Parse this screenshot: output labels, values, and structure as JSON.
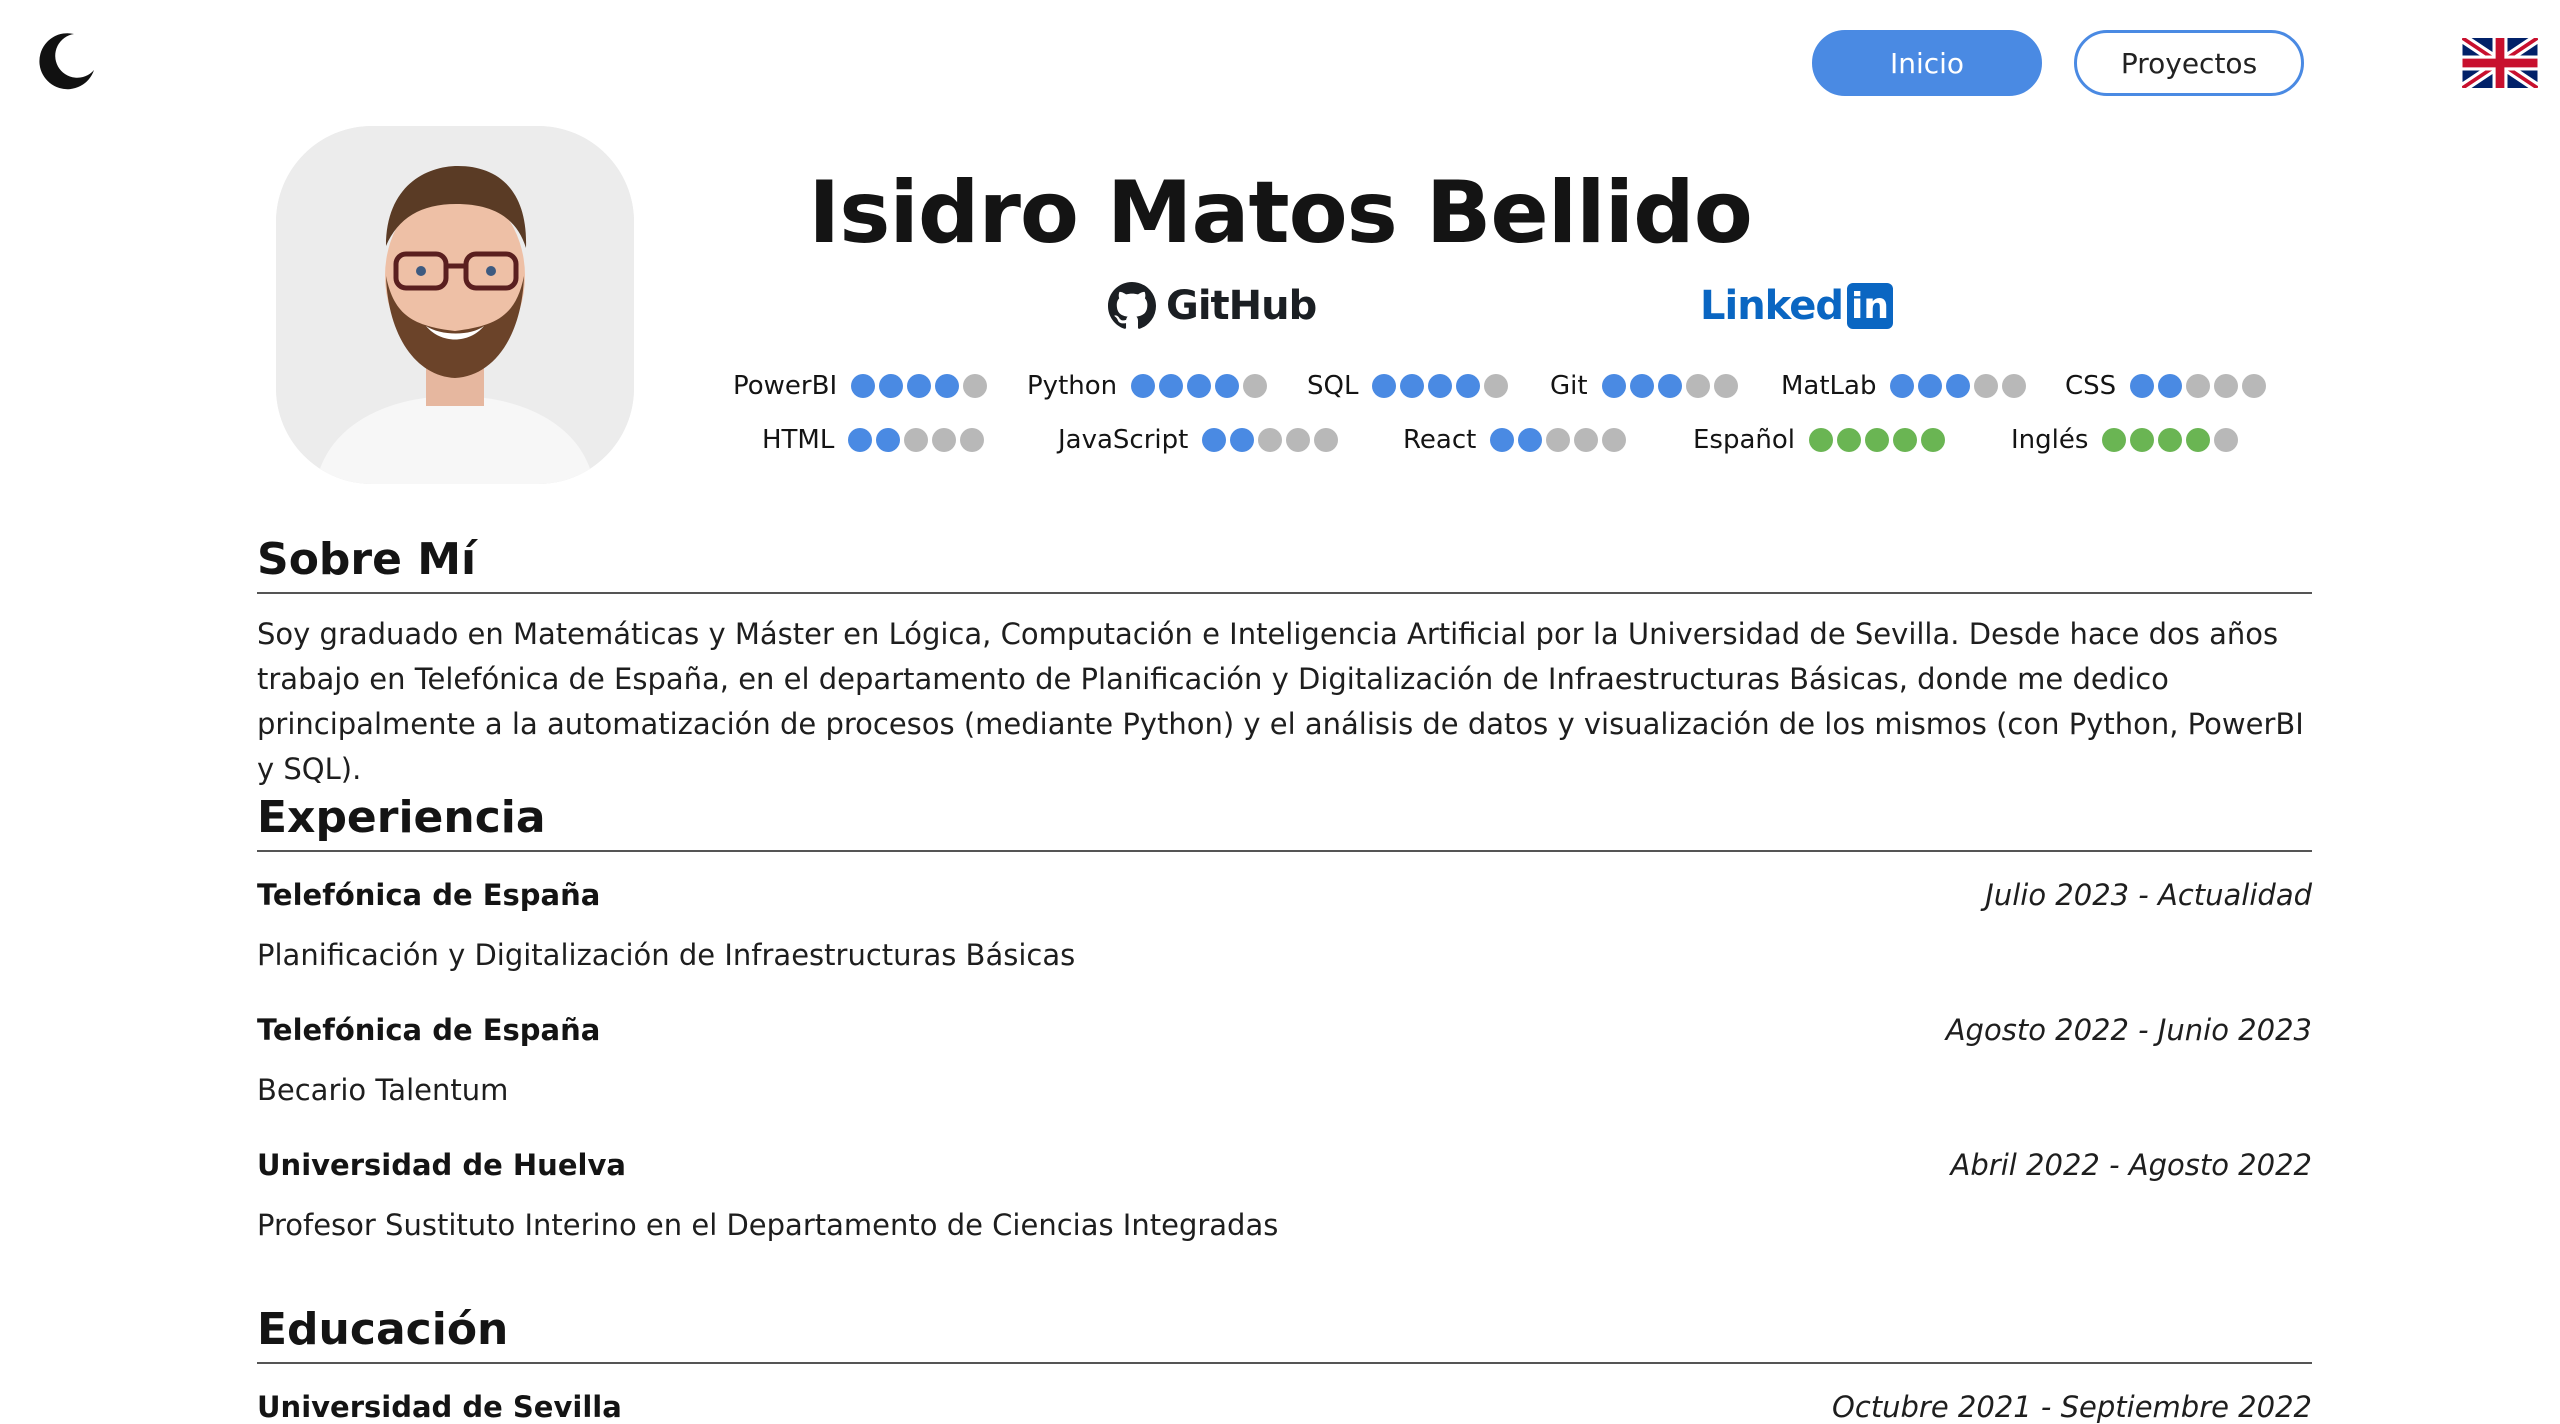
{
  "nav": {
    "home_label": "Inicio",
    "projects_label": "Proyectos",
    "theme_icon": "moon-icon",
    "language_icon": "uk-flag-icon"
  },
  "profile": {
    "name": "Isidro Matos Bellido",
    "github_label": "GitHub",
    "linkedin_label": "Linked",
    "linkedin_box": "in"
  },
  "skills": [
    {
      "label": "PowerBI",
      "level": 4,
      "max": 5,
      "color": "#4a8ae3"
    },
    {
      "label": "Python",
      "level": 4,
      "max": 5,
      "color": "#4a8ae3"
    },
    {
      "label": "SQL",
      "level": 4,
      "max": 5,
      "color": "#4a8ae3"
    },
    {
      "label": "Git",
      "level": 3,
      "max": 5,
      "color": "#4a8ae3"
    },
    {
      "label": "MatLab",
      "level": 3,
      "max": 5,
      "color": "#4a8ae3"
    },
    {
      "label": "CSS",
      "level": 2,
      "max": 5,
      "color": "#4a8ae3"
    },
    {
      "label": "HTML",
      "level": 2,
      "max": 5,
      "color": "#4a8ae3"
    },
    {
      "label": "JavaScript",
      "level": 2,
      "max": 5,
      "color": "#4a8ae3"
    },
    {
      "label": "React",
      "level": 2,
      "max": 5,
      "color": "#4a8ae3"
    },
    {
      "label": "Español",
      "level": 5,
      "max": 5,
      "color": "#6ab553"
    },
    {
      "label": "Inglés",
      "level": 4,
      "max": 5,
      "color": "#6ab553"
    }
  ],
  "about": {
    "heading": "Sobre Mí",
    "text": "Soy graduado en Matemáticas y Máster en Lógica, Computación e Inteligencia Artificial por la Universidad de Sevilla. Desde hace dos años trabajo en Telefónica de España, en el departamento de Planificación y Digitalización de Infraestructuras Básicas, donde me dedico principalmente a la automatización de procesos (mediante Python) y el análisis de datos y visualización de los mismos (con Python, PowerBI y SQL)."
  },
  "experience": {
    "heading": "Experiencia",
    "items": [
      {
        "org": "Telefónica de España",
        "date": "Julio 2023 - Actualidad",
        "role": "Planificación y Digitalización de Infraestructuras Básicas"
      },
      {
        "org": "Telefónica de España",
        "date": "Agosto 2022 - Junio 2023",
        "role": "Becario Talentum"
      },
      {
        "org": "Universidad de Huelva",
        "date": "Abril 2022 - Agosto 2022",
        "role": "Profesor Sustituto Interino en el Departamento de Ciencias Integradas"
      }
    ]
  },
  "education": {
    "heading": "Educación",
    "items": [
      {
        "org": "Universidad de Sevilla",
        "date": "Octubre 2021 - Septiembre 2022"
      }
    ]
  }
}
